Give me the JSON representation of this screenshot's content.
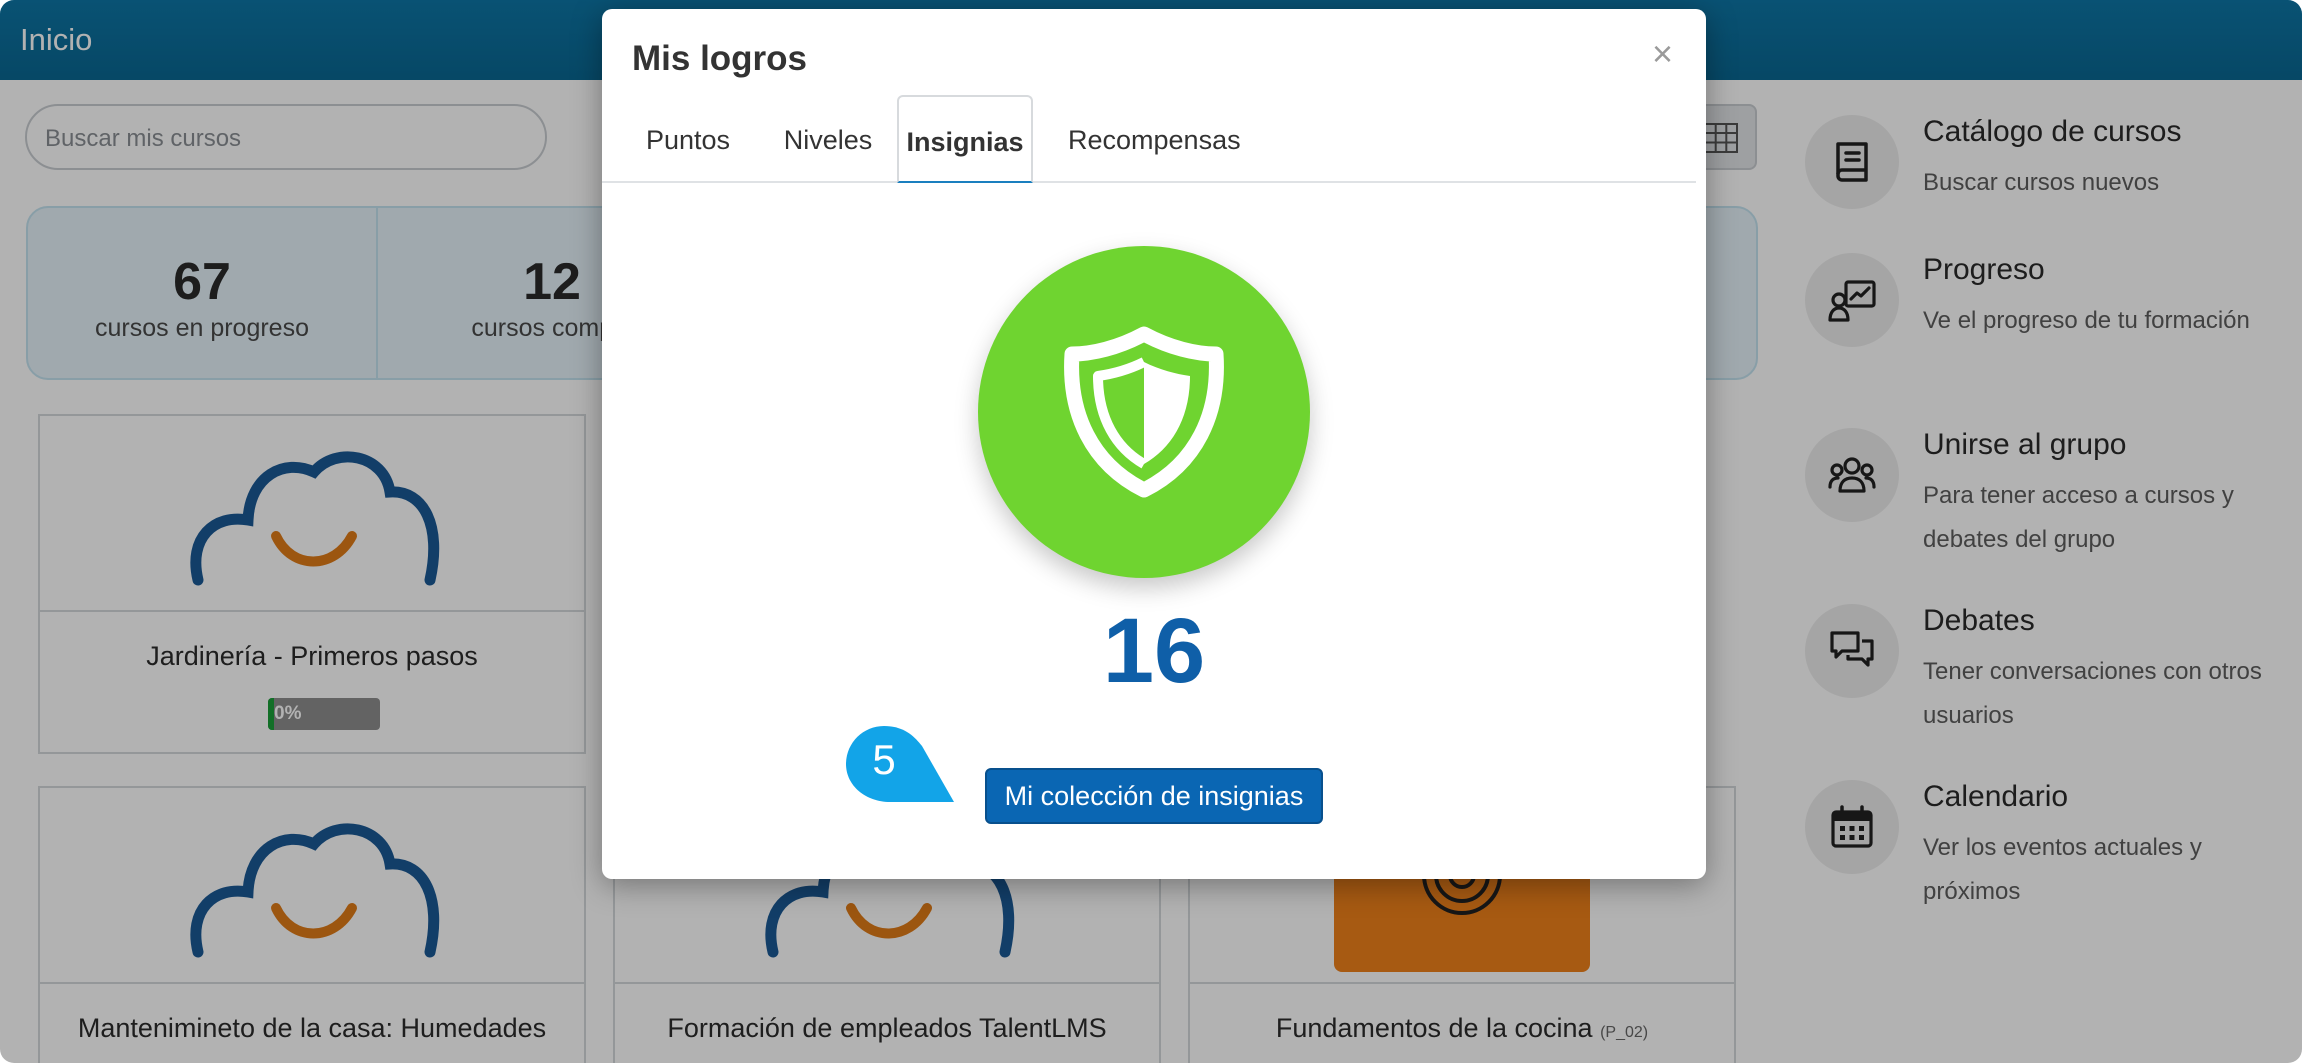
{
  "app": {
    "title": "Inicio",
    "search_placeholder": "Buscar mis cursos"
  },
  "stats": [
    {
      "value": "67",
      "label": "cursos en progreso"
    },
    {
      "value": "12",
      "label": "cursos comple"
    }
  ],
  "courses": [
    {
      "name": "Jardinería - Primeros pasos",
      "progress_label": "0%",
      "progress": 0.05
    },
    {
      "name": "Mantenimineto de la casa: Humedades"
    },
    {
      "name": "Formación de empleados TalentLMS"
    },
    {
      "name": "Fundamentos de la cocina",
      "code": "(P_02)"
    }
  ],
  "sidebar": {
    "items": [
      {
        "title": "Catálogo de cursos",
        "desc": "Buscar cursos nuevos",
        "icon": "book-icon"
      },
      {
        "title": "Progreso",
        "desc": "Ve el progreso de tu formación",
        "icon": "progress-chart-icon"
      },
      {
        "title": "Unirse al grupo",
        "desc": "Para tener acceso a cursos y debates del grupo",
        "icon": "group-icon"
      },
      {
        "title": "Debates",
        "desc": "Tener conversaciones con otros usuarios",
        "icon": "chat-bubbles-icon"
      },
      {
        "title": "Calendario",
        "desc": "Ver los eventos actuales y próximos",
        "icon": "calendar-icon"
      }
    ]
  },
  "modal": {
    "title": "Mis logros",
    "close_glyph": "×",
    "tabs": [
      {
        "label": "Puntos"
      },
      {
        "label": "Niveles"
      },
      {
        "label": "Insignias",
        "active": true
      },
      {
        "label": "Recompensas"
      }
    ],
    "badge_icon": "shield-icon",
    "badge_count": "16",
    "collection_button": "Mi colección de insignias",
    "step_marker": "5"
  },
  "colors": {
    "topbar": "#0b6d9b",
    "badge_green": "#6fd430",
    "count_blue": "#0f5fa8",
    "button_blue": "#0a66b3",
    "step_marker": "#12a4e8",
    "cloud_blue": "#1b5a96",
    "smile_orange": "#e07b17",
    "card_orange": "#f0811a"
  }
}
